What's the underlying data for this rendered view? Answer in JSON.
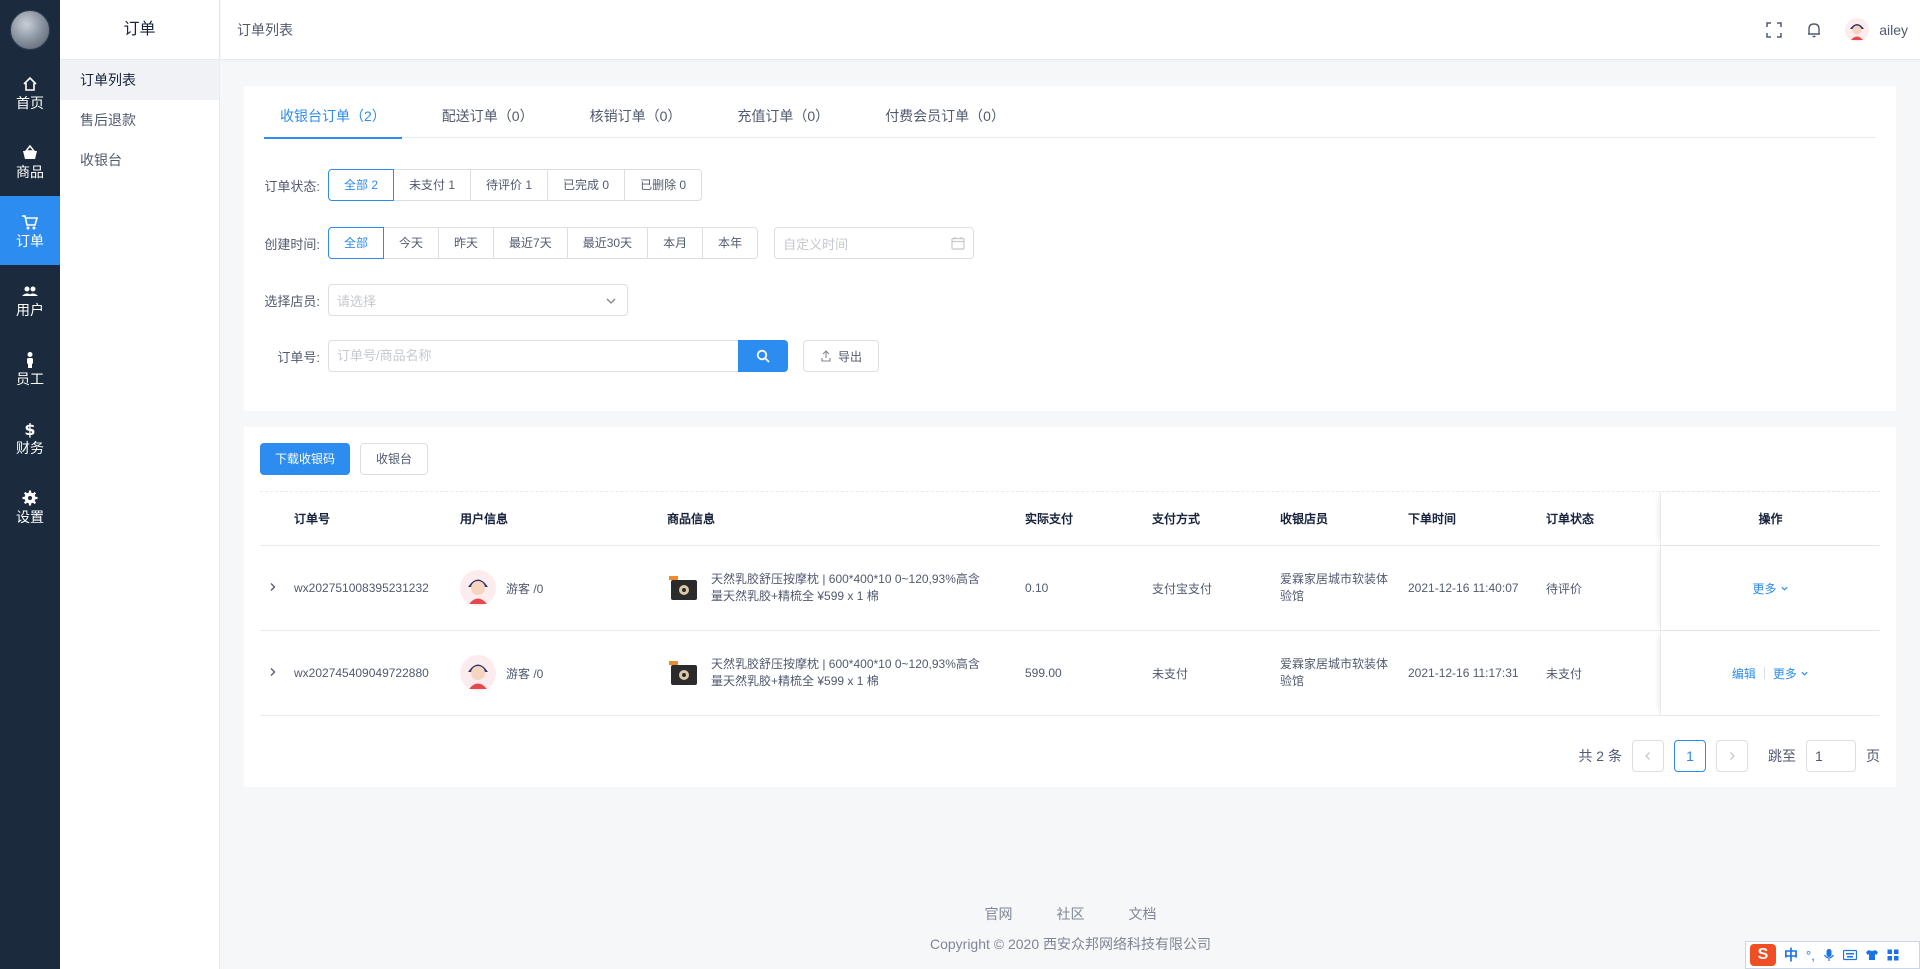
{
  "nav": [
    {
      "label": "首页",
      "icon": "home-icon"
    },
    {
      "label": "商品",
      "icon": "basket-icon"
    },
    {
      "label": "订单",
      "icon": "cart-icon",
      "active": true
    },
    {
      "label": "用户",
      "icon": "users-icon"
    },
    {
      "label": "员工",
      "icon": "person-icon"
    },
    {
      "label": "财务",
      "icon": "dollar-icon"
    },
    {
      "label": "设置",
      "icon": "gear-icon"
    }
  ],
  "subnav": {
    "title": "订单",
    "items": [
      "订单列表",
      "售后退款",
      "收银台"
    ]
  },
  "header": {
    "breadcrumb": "订单列表",
    "username": "ailey"
  },
  "tabs": [
    "收银台订单（2）",
    "配送订单（0）",
    "核销订单（0）",
    "充值订单（0）",
    "付费会员订单（0）"
  ],
  "filters": {
    "status_label": "订单状态:",
    "status_options": [
      "全部 2",
      "未支付 1",
      "待评价 1",
      "已完成 0",
      "已删除 0"
    ],
    "time_label": "创建时间:",
    "time_options": [
      "全部",
      "今天",
      "昨天",
      "最近7天",
      "最近30天",
      "本月",
      "本年"
    ],
    "date_placeholder": "自定义时间",
    "staff_label": "选择店员:",
    "staff_placeholder": "请选择",
    "order_label": "订单号:",
    "order_placeholder": "订单号/商品名称",
    "export_label": "导出"
  },
  "table_actions": {
    "download_label": "下载收银码",
    "cashier_label": "收银台"
  },
  "table": {
    "headers": [
      "订单号",
      "用户信息",
      "商品信息",
      "实际支付",
      "支付方式",
      "收银店员",
      "下单时间",
      "订单状态",
      "操作"
    ],
    "rows": [
      {
        "order_no": "wx202751008395231232",
        "user": "游客 /0",
        "product": "天然乳胶舒压按摩枕 | 600*400*10 0~120,93%高含量天然乳胶+精梳全 ¥599 x 1 棉",
        "paid": "0.10",
        "pay_method": "支付宝支付",
        "staff": "爱霖家居城市软装体验馆",
        "time": "2021-12-16 11:40:07",
        "status": "待评价",
        "edit": "",
        "more": "更多"
      },
      {
        "order_no": "wx202745409049722880",
        "user": "游客 /0",
        "product": "天然乳胶舒压按摩枕 | 600*400*10 0~120,93%高含量天然乳胶+精梳全 ¥599 x 1 棉",
        "paid": "599.00",
        "pay_method": "未支付",
        "staff": "爱霖家居城市软装体验馆",
        "time": "2021-12-16 11:17:31",
        "status": "未支付",
        "edit": "编辑",
        "more": "更多"
      }
    ]
  },
  "pagination": {
    "total": "共 2 条",
    "current": "1",
    "jump_label": "跳至",
    "jump_value": "1",
    "page_suffix": "页"
  },
  "footer": {
    "links": [
      "官网",
      "社区",
      "文档"
    ],
    "copyright": "Copyright © 2020 西安众邦网络科技有限公司"
  },
  "ime": {
    "logo": "S",
    "lang": "中",
    "punct": "°,"
  },
  "colors": {
    "primary": "#2d8cf0",
    "nav_bg": "#1b2a3d"
  }
}
